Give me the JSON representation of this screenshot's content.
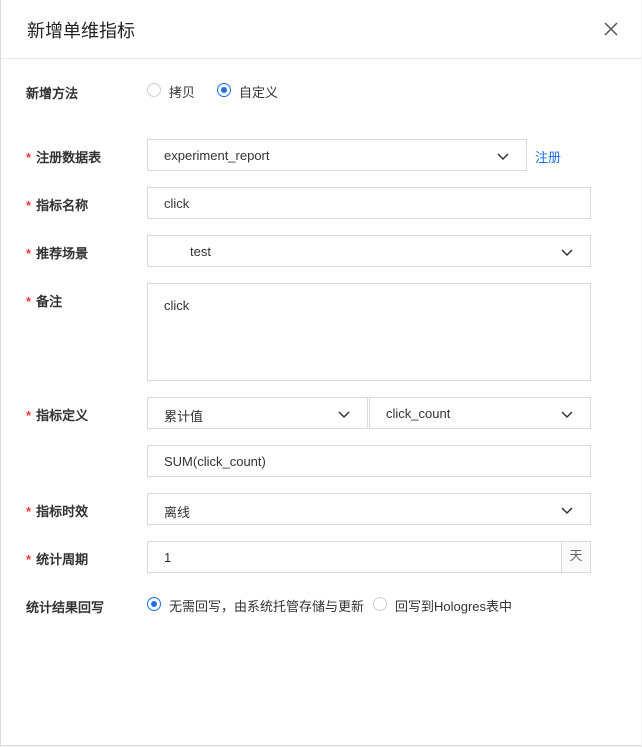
{
  "dialog": {
    "title": "新增单维指标"
  },
  "form": {
    "method": {
      "label": "新增方法",
      "options": [
        "拷贝",
        "自定义"
      ],
      "selected": "自定义"
    },
    "registry_table": {
      "label": "注册数据表",
      "value": "experiment_report",
      "link": "注册"
    },
    "metric_name": {
      "label": "指标名称",
      "value": "click"
    },
    "scene": {
      "label": "推荐场景",
      "value": "test"
    },
    "remark": {
      "label": "备注",
      "value": "click"
    },
    "definition": {
      "label": "指标定义",
      "aggregation": "累计值",
      "field": "click_count",
      "expression": "SUM(click_count)"
    },
    "timeliness": {
      "label": "指标时效",
      "value": "离线"
    },
    "period": {
      "label": "统计周期",
      "value": "1",
      "unit": "天"
    },
    "writeback": {
      "label": "统计结果回写",
      "options": [
        "无需回写，由系统托管存储与更新",
        "回写到Hologres表中"
      ],
      "selected": "无需回写，由系统托管存储与更新"
    }
  },
  "colors": {
    "accent": "#1f6fe8",
    "required": "#e23c39"
  }
}
